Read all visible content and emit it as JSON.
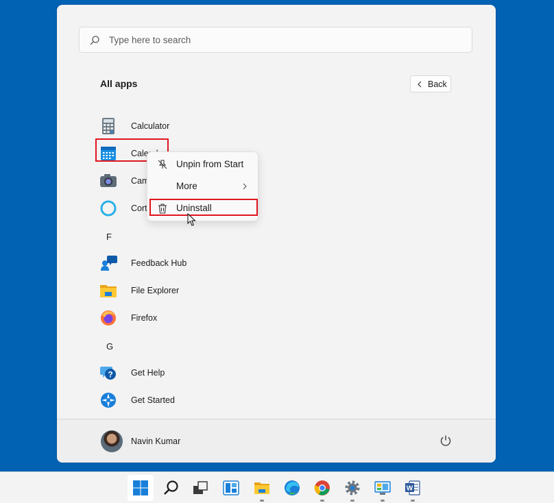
{
  "search": {
    "placeholder": "Type here to search",
    "icon": "search-icon"
  },
  "header": {
    "title": "All apps",
    "back_label": "Back"
  },
  "apps": [
    {
      "name": "Calculator",
      "icon": "calculator-icon"
    },
    {
      "name": "Calendar",
      "icon": "calendar-icon"
    },
    {
      "name": "Camera",
      "icon": "camera-icon"
    },
    {
      "name": "Cortana",
      "icon": "cortana-icon"
    },
    {
      "name": "Feedback Hub",
      "icon": "feedback-hub-icon"
    },
    {
      "name": "File Explorer",
      "icon": "file-explorer-icon"
    },
    {
      "name": "Firefox",
      "icon": "firefox-icon"
    },
    {
      "name": "Get Help",
      "icon": "get-help-icon"
    },
    {
      "name": "Get Started",
      "icon": "get-started-icon"
    }
  ],
  "visible_app_labels": {
    "camera": "Cam",
    "cortana": "Cort"
  },
  "letters": [
    "F",
    "G"
  ],
  "context_menu": {
    "items": [
      {
        "label": "Unpin from Start",
        "icon": "unpin-icon"
      },
      {
        "label": "More",
        "icon": "chevron-right-icon"
      },
      {
        "label": "Uninstall",
        "icon": "trash-icon"
      }
    ]
  },
  "user": {
    "name": "Navin Kumar"
  },
  "taskbar": {
    "items": [
      "start-icon",
      "search-icon",
      "task-view-icon",
      "widgets-icon",
      "file-explorer-icon",
      "edge-icon",
      "chrome-icon",
      "settings-icon",
      "control-panel-icon",
      "word-icon"
    ]
  },
  "colors": {
    "desktop": "#0161b2",
    "highlight": "#e0141e",
    "accent": "#0078d4"
  }
}
